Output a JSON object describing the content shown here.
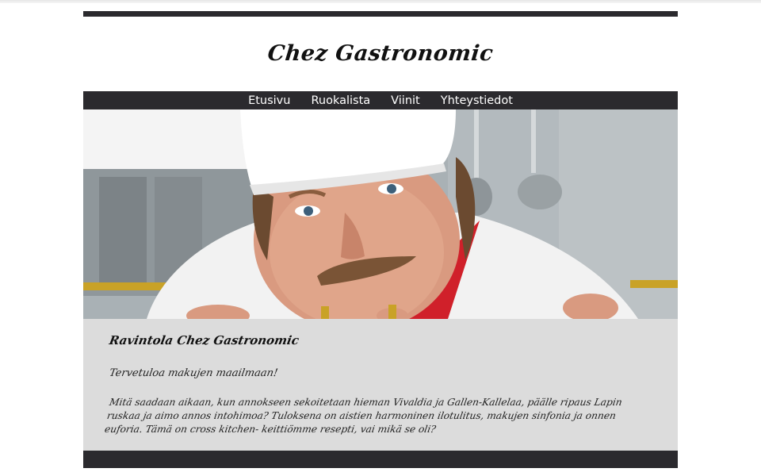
{
  "site": {
    "title": "Chez Gastronomic"
  },
  "nav": {
    "items": [
      {
        "label": "Etusivu"
      },
      {
        "label": "Ruokalista"
      },
      {
        "label": "Viinit"
      },
      {
        "label": "Yhteystiedot"
      }
    ]
  },
  "content": {
    "title": "Ravintola Chez Gastronomic",
    "subtitle": "Tervetuloa makujen maailmaan!",
    "body": "Mitä saadaan aikaan, kun annokseen sekoitetaan hieman Vivaldia ja Gallen-Kallelaa, päälle ripaus Lapin ruskaa ja aimo annos intohimoa? Tuloksena on aistien harmoninen ilotulitus, makujen sinfonia ja onnen euforia. Tämä on cross kitchen- keittiömme resepti, vai mikä se oli?"
  },
  "colors": {
    "bar": "#2b2a2e",
    "content_bg": "#dcdcdc",
    "scarf": "#d0202a"
  }
}
